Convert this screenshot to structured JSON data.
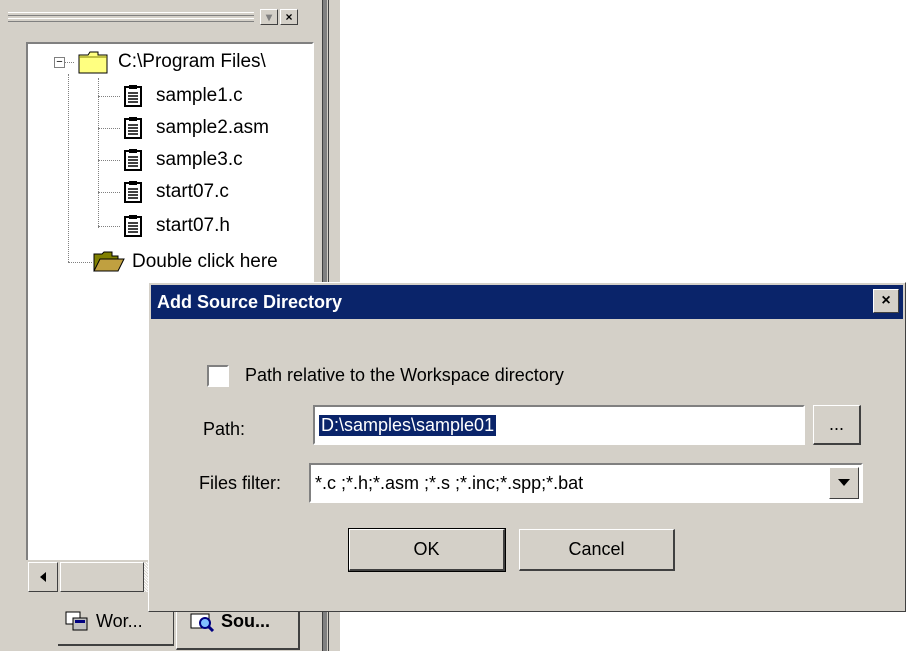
{
  "workspace": {
    "tree": {
      "root": {
        "label": "C:\\Program Files\\",
        "expander": "−"
      },
      "files": [
        "sample1.c",
        "sample2.asm",
        "sample3.c",
        "start07.c",
        "start07.h"
      ],
      "add_item": "Double click here"
    },
    "panel_buttons": {
      "minimize": "▾",
      "close": "×"
    },
    "tabs": [
      {
        "label": "Wor...",
        "icon": "workspace-icon"
      },
      {
        "label": "Sou...",
        "icon": "source-icon",
        "active": true
      }
    ]
  },
  "dialog": {
    "title": "Add Source Directory",
    "close_glyph": "×",
    "checkbox_label": "Path relative to the Workspace directory",
    "checkbox_checked": false,
    "path_label": "Path:",
    "path_value": "D:\\samples\\sample01",
    "browse_label": "...",
    "filter_label": "Files filter:",
    "filter_value": "*.c ;*.h;*.asm ;*.s ;*.inc;*.spp;*.bat",
    "ok_label": "OK",
    "cancel_label": "Cancel"
  },
  "colors": {
    "title_bar": "#0a246a",
    "face": "#d4d0c8",
    "selection": "#0a246a"
  }
}
